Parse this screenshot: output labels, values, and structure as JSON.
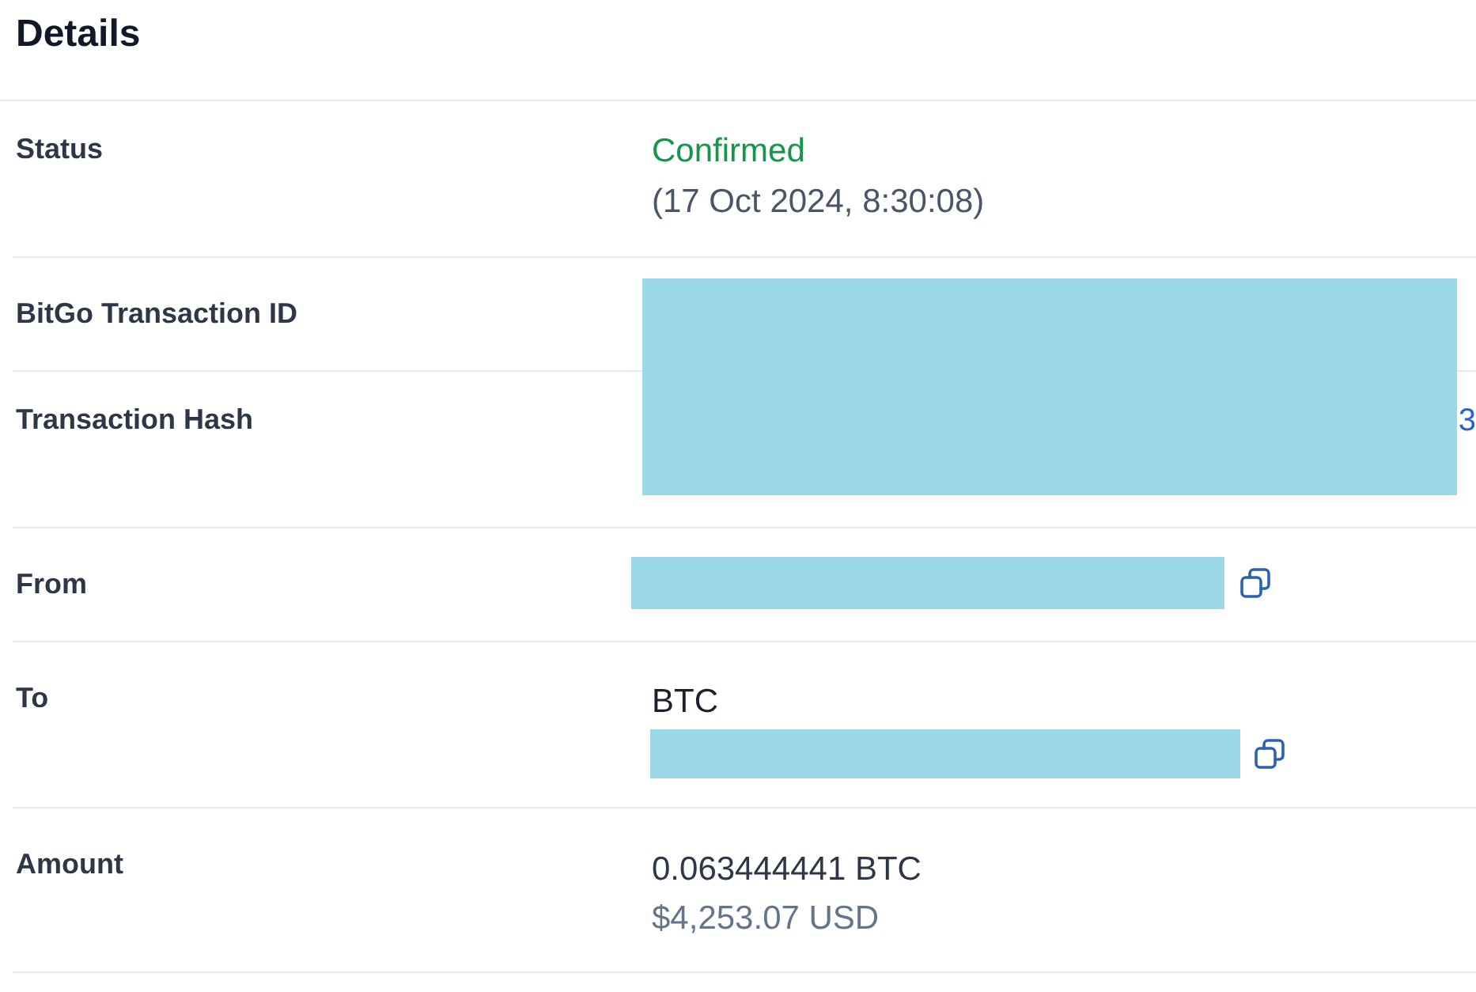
{
  "title": "Details",
  "rows": [
    {
      "kind": "status",
      "label": "Status",
      "status": "Confirmed",
      "timestamp": "(17 Oct 2024, 8:30:08)"
    },
    {
      "kind": "reference",
      "label": "BitGo Transaction ID",
      "redacted": true
    },
    {
      "kind": "link",
      "label": "Transaction Hash",
      "link": "3",
      "redacted": true
    },
    {
      "kind": "address",
      "label": "From",
      "redacted": true,
      "copyable": true
    },
    {
      "kind": "recipient",
      "label": "To",
      "coin": "BTC",
      "redacted": true,
      "copyable": true
    },
    {
      "kind": "amount",
      "label": "Amount",
      "amount": "0.063444441 BTC",
      "fiat": "$4,253.07 USD"
    }
  ]
}
